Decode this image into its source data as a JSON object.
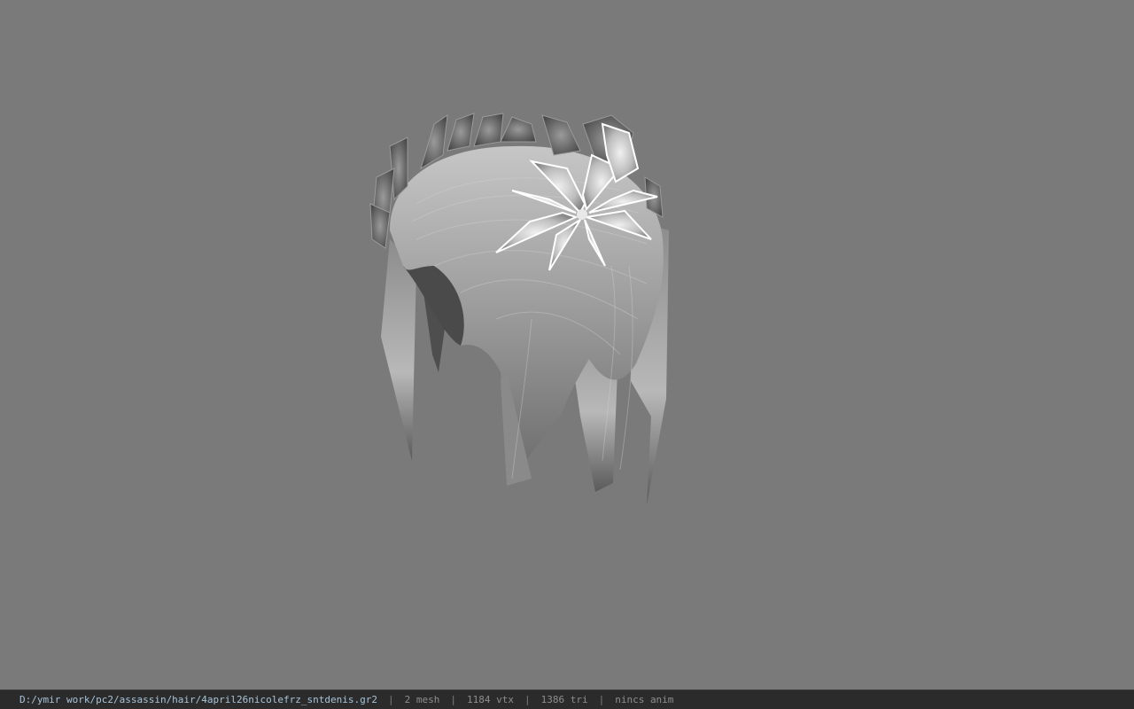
{
  "viewer": {
    "background_color": "#7a7a7a",
    "model_shading": "grayscale"
  },
  "status_bar": {
    "file_path": "D:/ymir work/pc2/assassin/hair/4april26nicolefrz_sntdenis.gr2",
    "separator": "|",
    "mesh_count": "2 mesh",
    "vertex_count": "1184 vtx",
    "triangle_count": "1386 tri",
    "anim_info": "nincs anim",
    "path_color": "#a7c4da",
    "text_color": "#8e8e8e"
  }
}
